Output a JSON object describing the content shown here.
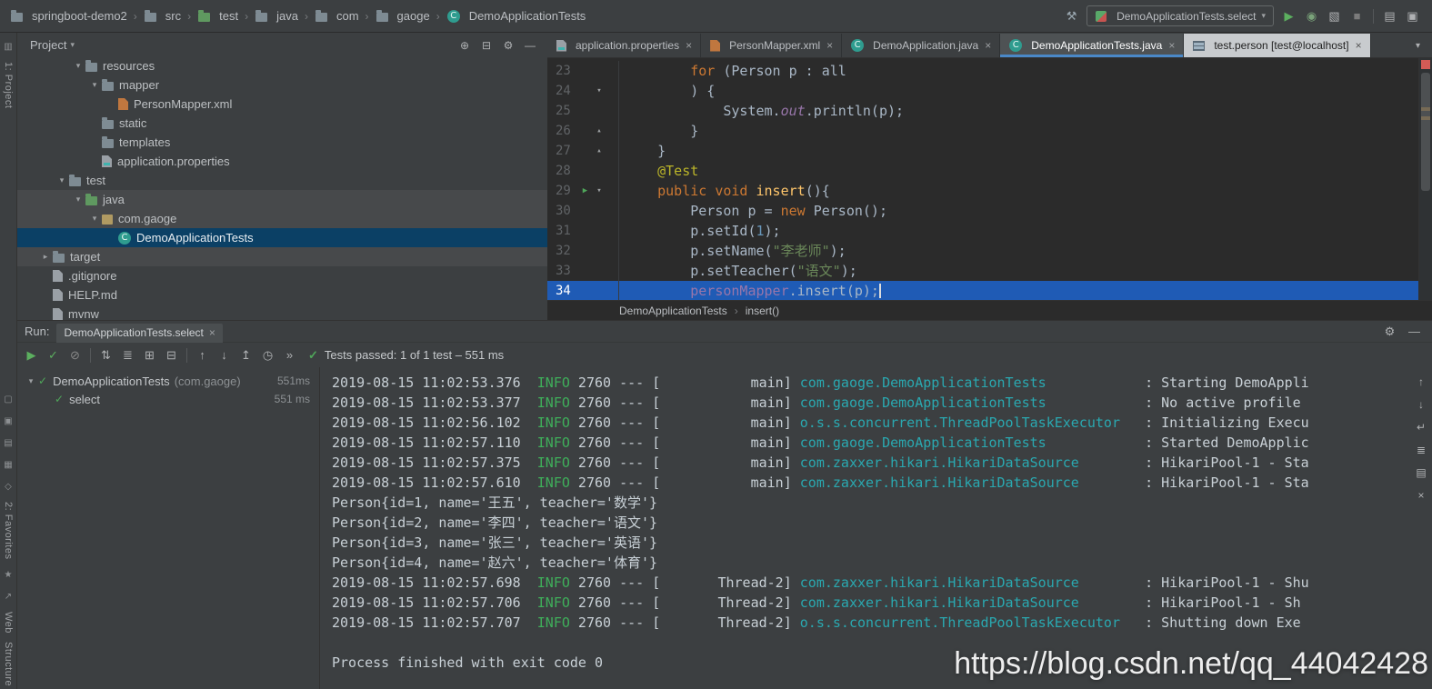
{
  "colors": {
    "window_bg": "#3c3f41",
    "editor_bg": "#2b2b2b",
    "caret_line_selection": "#1f5bb5",
    "tree_selection": "#0b4065",
    "active_tab_underline": "#4A88C7",
    "keyword_orange": "#CC7832",
    "string_green": "#6A8759",
    "annotation_yellow": "#BBB529",
    "info_green": "#3fae5a",
    "logger_cyan": "#2aa8b0",
    "error_red": "#d45b56",
    "test_passed_green": "#4fa65a"
  },
  "top_bar": {
    "breadcrumbs": [
      {
        "label": "springboot-demo2",
        "icon": "folder"
      },
      {
        "label": "src",
        "icon": "folder"
      },
      {
        "label": "test",
        "icon": "folder-green"
      },
      {
        "label": "java",
        "icon": "folder"
      },
      {
        "label": "com",
        "icon": "folder"
      },
      {
        "label": "gaoge",
        "icon": "folder"
      },
      {
        "label": "DemoApplicationTests",
        "icon": "class"
      }
    ],
    "build_icon": {
      "name": "build-hammer-icon",
      "glyph": "⚒",
      "color": "#9aa7b0"
    },
    "run_config_label": "DemoApplicationTests.select",
    "actions": [
      {
        "name": "run-button",
        "glyph": "▶",
        "color": "#5caf5f"
      },
      {
        "name": "debug-button",
        "glyph": "◉",
        "color": "#7aa37a"
      },
      {
        "name": "coverage-button",
        "glyph": "▧",
        "color": "#afb1b3"
      },
      {
        "name": "stop-button",
        "glyph": "■",
        "color": "#7b7b7b"
      },
      {
        "sep": true
      },
      {
        "name": "tool-windows-button",
        "glyph": "▤",
        "color": "#afb1b3"
      },
      {
        "name": "layout-button",
        "glyph": "▣",
        "color": "#afb1b3"
      }
    ]
  },
  "stripe": {
    "project_label": "1: Project",
    "favorites_label": "2: Favorites",
    "web_label": "Web",
    "structure_label": "Structure"
  },
  "project": {
    "header_title": "Project",
    "header_icons": [
      {
        "name": "select-opened-file-button",
        "glyph": "⊕"
      },
      {
        "name": "collapse-all-button",
        "glyph": "⊟"
      },
      {
        "name": "settings-gear-button",
        "glyph": "⚙"
      },
      {
        "name": "hide-panel-button",
        "glyph": "—"
      }
    ],
    "tree": [
      {
        "label": "resources",
        "depth": 3,
        "expander": "open",
        "icon": "folder"
      },
      {
        "label": "mapper",
        "depth": 4,
        "expander": "open",
        "icon": "folder"
      },
      {
        "label": "PersonMapper.xml",
        "depth": 5,
        "icon": "xml"
      },
      {
        "label": "static",
        "depth": 4,
        "icon": "folder"
      },
      {
        "label": "templates",
        "depth": 4,
        "icon": "folder"
      },
      {
        "label": "application.properties",
        "depth": 4,
        "icon": "props"
      },
      {
        "label": "test",
        "depth": 2,
        "expander": "open",
        "icon": "folder"
      },
      {
        "label": "java",
        "depth": 3,
        "expander": "open",
        "icon": "folder-green",
        "band": true
      },
      {
        "label": "com.gaoge",
        "depth": 4,
        "expander": "open",
        "icon": "package",
        "band": true
      },
      {
        "label": "DemoApplicationTests",
        "depth": 5,
        "icon": "class",
        "selected": true
      },
      {
        "label": "target",
        "depth": 1,
        "expander": "closed",
        "icon": "folder",
        "band": true
      },
      {
        "label": ".gitignore",
        "depth": 1,
        "icon": "file"
      },
      {
        "label": "HELP.md",
        "depth": 1,
        "icon": "file"
      },
      {
        "label": "mvnw",
        "depth": 1,
        "icon": "file"
      }
    ]
  },
  "editor": {
    "tabs": [
      {
        "label": "application.properties",
        "icon": "props"
      },
      {
        "label": "PersonMapper.xml",
        "icon": "xml"
      },
      {
        "label": "DemoApplication.java",
        "icon": "class"
      },
      {
        "label": "DemoApplicationTests.java",
        "icon": "class",
        "active": true
      },
      {
        "label": "test.person [test@localhost]",
        "icon": "table",
        "light": true
      }
    ],
    "breadcrumbs": [
      "DemoApplicationTests",
      "insert()"
    ],
    "lines": [
      {
        "no": 23,
        "indent": 8,
        "segs": [
          [
            "for",
            "kw"
          ],
          [
            " (Person p : all",
            "plain"
          ]
        ]
      },
      {
        "no": 24,
        "indent": 8,
        "fold": "open",
        "segs": [
          [
            ") {",
            "plain"
          ]
        ]
      },
      {
        "no": 25,
        "indent": 12,
        "segs": [
          [
            "System.",
            "plain"
          ],
          [
            "out",
            "staticfield"
          ],
          [
            ".println(p);",
            "plain"
          ]
        ]
      },
      {
        "no": 26,
        "indent": 8,
        "fold": "close",
        "segs": [
          [
            "}",
            "plain"
          ]
        ]
      },
      {
        "no": 27,
        "indent": 4,
        "fold": "close",
        "segs": [
          [
            "}",
            "plain"
          ]
        ]
      },
      {
        "no": 28,
        "indent": 4,
        "segs": [
          [
            "@Test",
            "ann"
          ]
        ]
      },
      {
        "no": 29,
        "indent": 4,
        "fold": "open",
        "run": true,
        "segs": [
          [
            "public void ",
            "kw"
          ],
          [
            "insert",
            "method"
          ],
          [
            "(){",
            "plain"
          ]
        ]
      },
      {
        "no": 30,
        "indent": 8,
        "segs": [
          [
            "Person p = ",
            "plain"
          ],
          [
            "new",
            "kw"
          ],
          [
            " Person();",
            "plain"
          ]
        ]
      },
      {
        "no": 31,
        "indent": 8,
        "segs": [
          [
            "p.setId(",
            "plain"
          ],
          [
            "1",
            "num"
          ],
          [
            ");",
            "plain"
          ]
        ]
      },
      {
        "no": 32,
        "indent": 8,
        "segs": [
          [
            "p.setName(",
            "plain"
          ],
          [
            "\"李老师\"",
            "str"
          ],
          [
            ");",
            "plain"
          ]
        ]
      },
      {
        "no": 33,
        "indent": 8,
        "segs": [
          [
            "p.setTeacher(",
            "plain"
          ],
          [
            "\"语文\"",
            "str"
          ],
          [
            ");",
            "plain"
          ]
        ]
      },
      {
        "no": 34,
        "indent": 8,
        "selected": true,
        "caret": true,
        "segs": [
          [
            "personMapper",
            "field"
          ],
          [
            ".insert(p);",
            "plain"
          ]
        ]
      }
    ]
  },
  "run_panel": {
    "tab_prefix": "Run:",
    "tab_label": "DemoApplicationTests.select",
    "tab_icons": [
      {
        "name": "settings-gear-button",
        "glyph": "⚙"
      },
      {
        "name": "hide-panel-button",
        "glyph": "—"
      }
    ],
    "toolbar": [
      {
        "name": "rerun-button",
        "glyph": "▶",
        "color": "#5caf5f"
      },
      {
        "name": "rerun-failed-tests-button",
        "glyph": "✓",
        "color": "#5caf5f"
      },
      {
        "name": "stop-button",
        "glyph": "⊘",
        "color": "#8a8a8a"
      },
      {
        "sep": true
      },
      {
        "name": "sort-alphabetically-button",
        "glyph": "⇅",
        "color": "#afb1b3"
      },
      {
        "name": "sort-by-duration-button",
        "glyph": "≣",
        "color": "#afb1b3"
      },
      {
        "name": "expand-all-button",
        "glyph": "⊞",
        "color": "#afb1b3"
      },
      {
        "name": "collapse-all-button",
        "glyph": "⊟",
        "color": "#afb1b3"
      },
      {
        "sep": true
      },
      {
        "name": "previous-occurrence-button",
        "glyph": "↑",
        "color": "#afb1b3"
      },
      {
        "name": "next-occurrence-button",
        "glyph": "↓",
        "color": "#afb1b3"
      },
      {
        "name": "import-test-results-button",
        "glyph": "↥",
        "color": "#afb1b3"
      },
      {
        "name": "test-history-button",
        "glyph": "◷",
        "color": "#afb1b3"
      },
      {
        "name": "more-chevron-icon",
        "glyph": "»",
        "color": "#afb1b3"
      }
    ],
    "status_text": "Tests passed: 1 of 1 test – 551 ms",
    "test_tree": [
      {
        "label": "DemoApplicationTests",
        "suffix": " (com.gaoge)",
        "time": "551ms",
        "depth": 0,
        "expander": true
      },
      {
        "label": "select",
        "time": "551 ms",
        "depth": 1
      }
    ],
    "console": [
      {
        "type": "log",
        "time": "2019-08-15 11:02:53.376",
        "level": "INFO",
        "pid": "2760",
        "thread": "main",
        "logger": "com.gaoge.DemoApplicationTests",
        "msg": "Starting DemoAppli"
      },
      {
        "type": "log",
        "time": "2019-08-15 11:02:53.377",
        "level": "INFO",
        "pid": "2760",
        "thread": "main",
        "logger": "com.gaoge.DemoApplicationTests",
        "msg": "No active profile"
      },
      {
        "type": "log",
        "time": "2019-08-15 11:02:56.102",
        "level": "INFO",
        "pid": "2760",
        "thread": "main",
        "logger": "o.s.s.concurrent.ThreadPoolTaskExecutor",
        "msg": "Initializing Execu"
      },
      {
        "type": "log",
        "time": "2019-08-15 11:02:57.110",
        "level": "INFO",
        "pid": "2760",
        "thread": "main",
        "logger": "com.gaoge.DemoApplicationTests",
        "msg": "Started DemoApplic"
      },
      {
        "type": "log",
        "time": "2019-08-15 11:02:57.375",
        "level": "INFO",
        "pid": "2760",
        "thread": "main",
        "logger": "com.zaxxer.hikari.HikariDataSource",
        "msg": "HikariPool-1 - Sta"
      },
      {
        "type": "log",
        "time": "2019-08-15 11:02:57.610",
        "level": "INFO",
        "pid": "2760",
        "thread": "main",
        "logger": "com.zaxxer.hikari.HikariDataSource",
        "msg": "HikariPool-1 - Sta"
      },
      {
        "type": "plain",
        "text": "Person{id=1, name='王五', teacher='数学'}"
      },
      {
        "type": "plain",
        "text": "Person{id=2, name='李四', teacher='语文'}"
      },
      {
        "type": "plain",
        "text": "Person{id=3, name='张三', teacher='英语'}"
      },
      {
        "type": "plain",
        "text": "Person{id=4, name='赵六', teacher='体育'}"
      },
      {
        "type": "log",
        "time": "2019-08-15 11:02:57.698",
        "level": "INFO",
        "pid": "2760",
        "thread": "Thread-2",
        "logger": "com.zaxxer.hikari.HikariDataSource",
        "msg": "HikariPool-1 - Shu"
      },
      {
        "type": "log",
        "time": "2019-08-15 11:02:57.706",
        "level": "INFO",
        "pid": "2760",
        "thread": "Thread-2",
        "logger": "com.zaxxer.hikari.HikariDataSource",
        "msg": "HikariPool-1 - Sh"
      },
      {
        "type": "log",
        "time": "2019-08-15 11:02:57.707",
        "level": "INFO",
        "pid": "2760",
        "thread": "Thread-2",
        "logger": "o.s.s.concurrent.ThreadPoolTaskExecutor",
        "msg": "Shutting down Exe"
      },
      {
        "type": "plain",
        "text": ""
      },
      {
        "type": "plain",
        "text": "Process finished with exit code 0"
      }
    ],
    "console_icons": [
      {
        "name": "scroll-to-top-button",
        "glyph": "↑"
      },
      {
        "name": "scroll-to-bottom-button",
        "glyph": "↓"
      },
      {
        "name": "soft-wrap-button",
        "glyph": "↵"
      },
      {
        "name": "scroll-to-end-button",
        "glyph": "≣"
      },
      {
        "name": "print-console-button",
        "glyph": "▤"
      },
      {
        "name": "clear-all-button",
        "glyph": "×"
      }
    ]
  },
  "watermark": {
    "text": "https://blog.csdn.net/qq_44042428"
  }
}
